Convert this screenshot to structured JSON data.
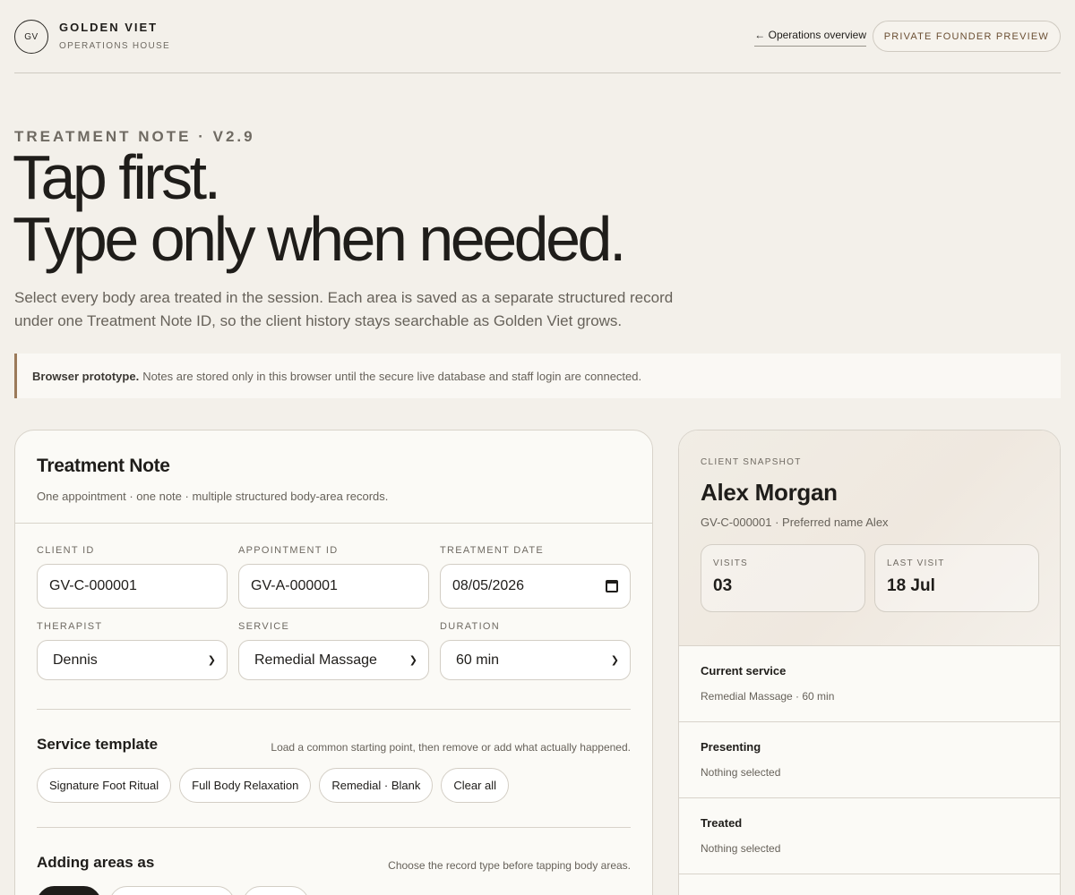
{
  "brand": {
    "logo": "GV",
    "name": "GOLDEN VIET",
    "subtitle": "OPERATIONS HOUSE"
  },
  "nav": {
    "back_link": "← Operations overview",
    "preview_badge": "PRIVATE FOUNDER PREVIEW"
  },
  "hero": {
    "eyebrow": "TREATMENT NOTE · V2.9",
    "title_line1": "Tap first.",
    "title_line2": "Type only when needed.",
    "description": "Select every body area treated in the session. Each area is saved as a separate structured record under one Treatment Note ID, so the client history stays searchable as Golden Viet grows."
  },
  "notice": {
    "strong": "Browser prototype.",
    "text": "Notes are stored only in this browser until the secure live database and staff login are connected."
  },
  "note_card": {
    "title": "Treatment Note",
    "subtitle": "One appointment · one note · multiple structured body-area records.",
    "fields": {
      "client_id": {
        "label": "CLIENT ID",
        "value": "GV-C-000001"
      },
      "appointment_id": {
        "label": "APPOINTMENT ID",
        "value": "GV-A-000001"
      },
      "treatment_date": {
        "label": "TREATMENT DATE",
        "value": "08/05/2026"
      },
      "therapist": {
        "label": "THERAPIST",
        "value": "Dennis"
      },
      "service": {
        "label": "SERVICE",
        "value": "Remedial Massage"
      },
      "duration": {
        "label": "DURATION",
        "value": "60 min"
      }
    },
    "template": {
      "title": "Service template",
      "hint": "Load a common starting point, then remove or add what actually happened.",
      "options": [
        "Signature Foot Ritual",
        "Full Body Relaxation",
        "Remedial · Blank",
        "Clear all"
      ]
    },
    "adding": {
      "title": "Adding areas as",
      "hint": "Choose the record type before tapping body areas."
    }
  },
  "snapshot": {
    "eyebrow": "CLIENT SNAPSHOT",
    "name": "Alex Morgan",
    "meta": "GV-C-000001 · Preferred name Alex",
    "stats": [
      {
        "label": "VISITS",
        "value": "03"
      },
      {
        "label": "LAST VISIT",
        "value": "18 Jul"
      }
    ],
    "rows": [
      {
        "title": "Current service",
        "value": "Remedial Massage · 60 min"
      },
      {
        "title": "Presenting",
        "value": "Nothing selected"
      },
      {
        "title": "Treated",
        "value": "Nothing selected"
      }
    ]
  }
}
